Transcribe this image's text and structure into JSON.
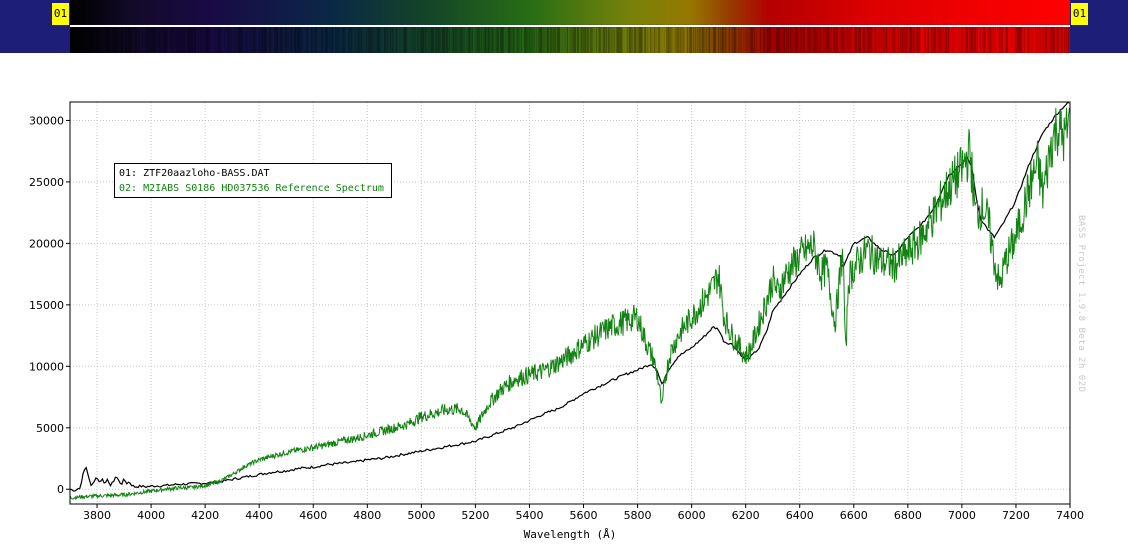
{
  "strip": {
    "left_tag": "01",
    "right_tag": "01"
  },
  "watermark": "BASS Project 1.9.8 Beta 2h 02D",
  "chart_data": {
    "type": "line",
    "title": "",
    "xlabel": "Wavelength (Å)",
    "ylabel": "",
    "xlim": [
      3700,
      7400
    ],
    "ylim": [
      -1200,
      31500
    ],
    "xticks": [
      3800,
      4000,
      4200,
      4400,
      4600,
      4800,
      5000,
      5200,
      5400,
      5600,
      5800,
      6000,
      6200,
      6400,
      6600,
      6800,
      7000,
      7200,
      7400
    ],
    "yticks": [
      0,
      5000,
      10000,
      15000,
      20000,
      25000,
      30000
    ],
    "grid": true,
    "legend_position": "top-left",
    "series": [
      {
        "name": "01: ZTF20aazloho-BASS.DAT",
        "color": "#000000",
        "x": [
          3700,
          3720,
          3740,
          3750,
          3760,
          3770,
          3780,
          3790,
          3800,
          3810,
          3820,
          3830,
          3840,
          3850,
          3860,
          3870,
          3880,
          3890,
          3900,
          3910,
          3920,
          3930,
          3940,
          3960,
          3980,
          4000,
          4050,
          4100,
          4150,
          4200,
          4250,
          4300,
          4350,
          4400,
          4450,
          4500,
          4550,
          4600,
          4650,
          4700,
          4750,
          4800,
          4850,
          4900,
          4950,
          5000,
          5050,
          5100,
          5150,
          5200,
          5250,
          5300,
          5350,
          5400,
          5450,
          5500,
          5550,
          5600,
          5650,
          5700,
          5750,
          5800,
          5850,
          5870,
          5890,
          5910,
          5950,
          6000,
          6050,
          6080,
          6100,
          6120,
          6150,
          6180,
          6200,
          6220,
          6250,
          6280,
          6300,
          6350,
          6400,
          6450,
          6500,
          6550,
          6560,
          6570,
          6600,
          6650,
          6700,
          6750,
          6800,
          6850,
          6900,
          6950,
          7000,
          7020,
          7040,
          7050,
          7070,
          7100,
          7120,
          7150,
          7200,
          7250,
          7300,
          7350,
          7380,
          7400
        ],
        "y": [
          0,
          -100,
          200,
          1500,
          1800,
          800,
          300,
          700,
          1000,
          500,
          900,
          400,
          800,
          300,
          600,
          1100,
          700,
          400,
          800,
          500,
          600,
          300,
          200,
          250,
          200,
          250,
          300,
          400,
          450,
          500,
          600,
          800,
          1000,
          1200,
          1400,
          1500,
          1700,
          1800,
          2000,
          2100,
          2200,
          2400,
          2500,
          2700,
          2900,
          3100,
          3300,
          3500,
          3700,
          3900,
          4300,
          4700,
          5100,
          5600,
          6100,
          6500,
          7100,
          7800,
          8300,
          8800,
          9300,
          9700,
          10200,
          9800,
          8500,
          9600,
          10800,
          11500,
          12500,
          13200,
          13000,
          12000,
          11800,
          11000,
          10500,
          10800,
          11500,
          13000,
          14500,
          16000,
          17500,
          18800,
          19500,
          19000,
          18000,
          18500,
          20000,
          20500,
          19500,
          19000,
          20500,
          21500,
          23000,
          25500,
          26500,
          27000,
          26000,
          24000,
          22000,
          21000,
          20500,
          21500,
          23500,
          26500,
          29000,
          30500,
          31200,
          31500
        ]
      },
      {
        "name": "02: M2IABS S0186 HD037536 Reference Spectrum",
        "color": "#128212",
        "x": [
          3700,
          3750,
          3800,
          3850,
          3900,
          3950,
          4000,
          4050,
          4100,
          4150,
          4200,
          4250,
          4300,
          4350,
          4400,
          4450,
          4500,
          4550,
          4600,
          4650,
          4700,
          4750,
          4800,
          4850,
          4900,
          4950,
          5000,
          5050,
          5100,
          5150,
          5200,
          5250,
          5300,
          5350,
          5400,
          5450,
          5500,
          5550,
          5600,
          5650,
          5700,
          5750,
          5800,
          5830,
          5860,
          5880,
          5890,
          5900,
          5920,
          5950,
          6000,
          6050,
          6080,
          6100,
          6120,
          6150,
          6180,
          6200,
          6220,
          6250,
          6280,
          6300,
          6320,
          6350,
          6400,
          6450,
          6480,
          6500,
          6530,
          6560,
          6570,
          6580,
          6600,
          6650,
          6700,
          6750,
          6800,
          6850,
          6900,
          6950,
          7000,
          7030,
          7050,
          7080,
          7100,
          7120,
          7140,
          7160,
          7200,
          7250,
          7280,
          7300,
          7330,
          7350,
          7380,
          7400
        ],
        "y": [
          -700,
          -600,
          -550,
          -500,
          -450,
          -300,
          -150,
          0,
          100,
          150,
          300,
          600,
          1200,
          1900,
          2400,
          2700,
          3000,
          3200,
          3400,
          3600,
          3900,
          4100,
          4400,
          4700,
          5000,
          5300,
          5900,
          6200,
          6500,
          6500,
          5000,
          7000,
          8200,
          9000,
          9300,
          9600,
          10200,
          10900,
          11800,
          12500,
          13200,
          13600,
          14000,
          12000,
          10500,
          8500,
          6500,
          8800,
          11000,
          12500,
          14000,
          15500,
          16500,
          17500,
          14000,
          12500,
          11500,
          10800,
          11500,
          13500,
          15500,
          17000,
          16000,
          17500,
          19000,
          19800,
          17500,
          18000,
          13500,
          19500,
          10500,
          17000,
          18000,
          19500,
          18500,
          18200,
          19200,
          20500,
          22500,
          24500,
          26000,
          27500,
          22500,
          23000,
          21500,
          18500,
          16500,
          18500,
          20500,
          24500,
          26500,
          24000,
          28000,
          29500,
          28500,
          30000
        ]
      }
    ]
  }
}
